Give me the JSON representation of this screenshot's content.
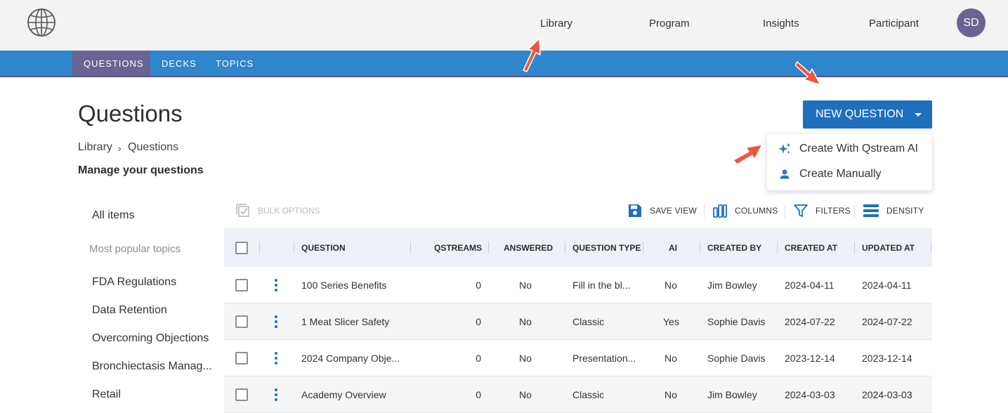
{
  "nav": {
    "links": [
      "Library",
      "Program",
      "Insights",
      "Participant"
    ],
    "avatar_initials": "SD"
  },
  "tabs": [
    "QUESTIONS",
    "DECKS",
    "TOPICS"
  ],
  "page": {
    "title": "Questions",
    "breadcrumb": [
      "Library",
      "›",
      "Questions"
    ],
    "subtitle": "Manage your questions"
  },
  "new_question": {
    "label": "NEW QUESTION",
    "menu": [
      "Create With Qstream AI",
      "Create Manually"
    ]
  },
  "sidebar": {
    "all_items": "All items",
    "popular_heading": "Most popular topics",
    "topics": [
      "FDA Regulations",
      "Data Retention",
      "Overcoming Objections",
      "Bronchiectasis Manag...",
      "Retail"
    ]
  },
  "toolbar": {
    "bulk": "BULK OPTIONS",
    "save_view": "SAVE VIEW",
    "columns": "COLUMNS",
    "filters": "FILTERS",
    "density": "DENSITY"
  },
  "table": {
    "headers": [
      "QUESTION",
      "QSTREAMS",
      "ANSWERED",
      "QUESTION TYPE",
      "AI",
      "CREATED BY",
      "CREATED AT",
      "UPDATED AT"
    ],
    "rows": [
      [
        "100 Series Benefits",
        "0",
        "No",
        "Fill in the bl...",
        "No",
        "Jim Bowley",
        "2024-04-11",
        "2024-04-11"
      ],
      [
        "1 Meat Slicer Safety",
        "0",
        "No",
        "Classic",
        "Yes",
        "Sophie Davis",
        "2024-07-22",
        "2024-07-22"
      ],
      [
        "2024 Company Obje...",
        "0",
        "No",
        "Presentation...",
        "No",
        "Sophie Davis",
        "2023-12-14",
        "2023-12-14"
      ],
      [
        "Academy Overview",
        "0",
        "No",
        "Classic",
        "No",
        "Jim Bowley",
        "2024-03-03",
        "2024-03-03"
      ]
    ]
  },
  "colors": {
    "tab_bar": "#2f86cc",
    "active_tab": "#6a6494",
    "primary_button": "#1f6fbf",
    "annotation_arrow": "#f0553b"
  }
}
